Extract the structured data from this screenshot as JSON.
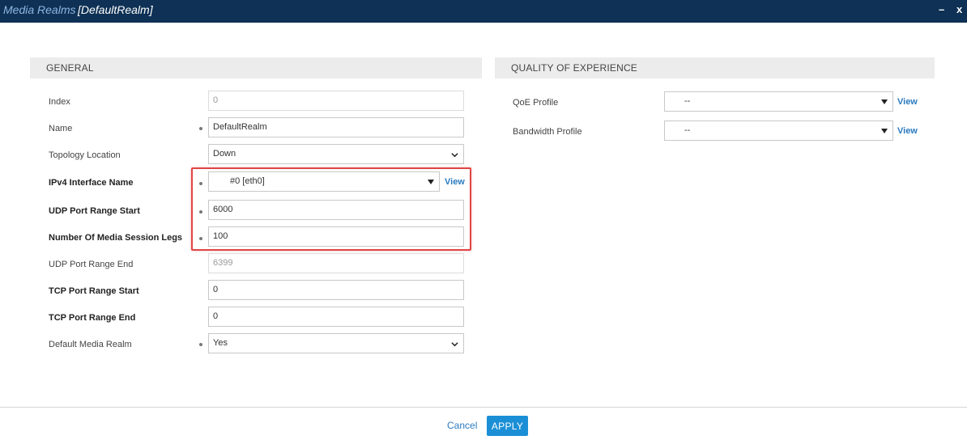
{
  "window": {
    "title": "Media Realms",
    "subtitle": "[DefaultRealm]",
    "minimize": "–",
    "close": "x"
  },
  "general": {
    "header": "GENERAL",
    "index": {
      "label": "Index",
      "value": "0"
    },
    "name": {
      "label": "Name",
      "value": "DefaultRealm"
    },
    "topology": {
      "label": "Topology Location",
      "value": "Down"
    },
    "ipv4": {
      "label": "IPv4 Interface Name",
      "value": "#0 [eth0]",
      "link": "View"
    },
    "udp_start": {
      "label": "UDP Port Range Start",
      "value": "6000"
    },
    "session_legs": {
      "label": "Number Of Media Session Legs",
      "value": "100"
    },
    "udp_end": {
      "label": "UDP Port Range End",
      "value": "6399"
    },
    "tcp_start": {
      "label": "TCP Port Range Start",
      "value": "0"
    },
    "tcp_end": {
      "label": "TCP Port Range End",
      "value": "0"
    },
    "default_realm": {
      "label": "Default Media Realm",
      "value": "Yes"
    }
  },
  "qoe": {
    "header": "QUALITY OF EXPERIENCE",
    "qoe_profile": {
      "label": "QoE Profile",
      "value": "--",
      "link": "View"
    },
    "bandwidth_profile": {
      "label": "Bandwidth Profile",
      "value": "--",
      "link": "View"
    }
  },
  "footer": {
    "cancel": "Cancel",
    "apply": "APPLY"
  },
  "colors": {
    "titlebar": "#0e3155",
    "accent": "#1b8fd6",
    "link": "#2a7bbf",
    "highlight": "#e04545"
  }
}
